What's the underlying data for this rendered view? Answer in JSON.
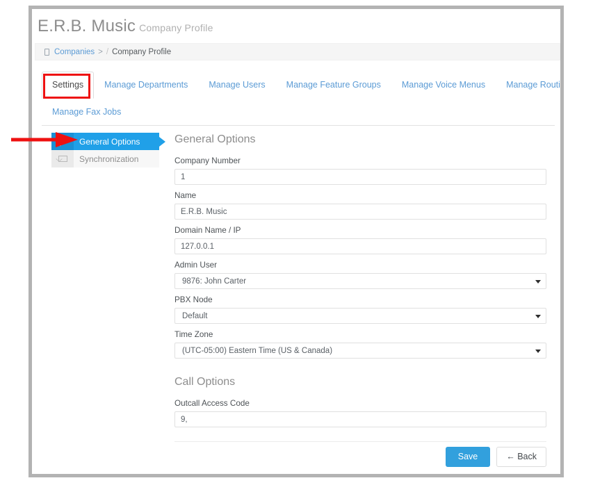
{
  "header": {
    "app_title": "E.R.B. Music",
    "app_subtitle": "Company Profile"
  },
  "breadcrumb": {
    "icon": "building-icon",
    "root_label": "Companies",
    "separator": ">",
    "slash": "/",
    "current_label": "Company Profile"
  },
  "tabs": {
    "row1": [
      {
        "label": "Settings",
        "active": true
      },
      {
        "label": "Manage Departments",
        "active": false
      },
      {
        "label": "Manage Users",
        "active": false
      },
      {
        "label": "Manage Feature Groups",
        "active": false
      },
      {
        "label": "Manage Voice Menus",
        "active": false
      },
      {
        "label": "Manage Routing Tables",
        "active": false
      }
    ],
    "row2": [
      {
        "label": "Manage Fax Jobs",
        "active": false
      }
    ]
  },
  "sidebar": {
    "items": [
      {
        "label": "General Options",
        "icon": "wrench-icon",
        "active": true
      },
      {
        "label": "Synchronization",
        "icon": "envelope-icon",
        "active": false
      }
    ]
  },
  "form": {
    "general_title": "General Options",
    "fields": [
      {
        "label": "Company Number",
        "value": "1",
        "type": "text"
      },
      {
        "label": "Name",
        "value": "E.R.B. Music",
        "type": "text"
      },
      {
        "label": "Domain Name / IP",
        "value": "127.0.0.1",
        "type": "text"
      },
      {
        "label": "Admin User",
        "value": "9876: John Carter",
        "type": "select"
      },
      {
        "label": "PBX Node",
        "value": "Default",
        "type": "select"
      },
      {
        "label": "Time Zone",
        "value": "(UTC-05:00) Eastern Time (US & Canada)",
        "type": "select"
      }
    ],
    "call_title": "Call Options",
    "call_fields": [
      {
        "label": "Outcall Access Code",
        "value": "9,",
        "type": "text"
      }
    ]
  },
  "footer": {
    "save_label": "Save",
    "back_label": "← Back"
  },
  "annotations": {
    "highlight_color": "#ee1111",
    "arrow_color": "#ee1111",
    "highlight_target": "Settings",
    "arrow_target": "General Options"
  },
  "colors": {
    "accent_blue": "#20a0e8",
    "link_blue": "#5b9bd5",
    "button_blue": "#32a0dd",
    "frame_gray": "#b3b3b3"
  }
}
